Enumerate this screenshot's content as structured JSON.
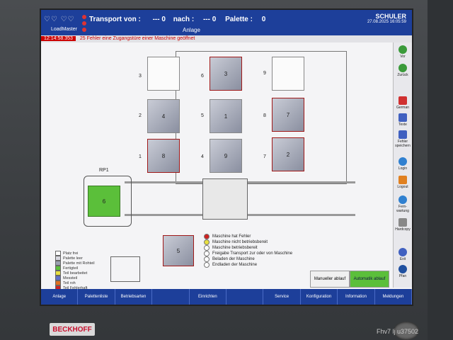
{
  "header": {
    "hearts": "♡♡ ♡♡",
    "loadmaster": "LoadMaster",
    "transport_label": "Transport von :",
    "transport_from": "---  0",
    "nach_label": "nach :",
    "transport_to": "---  0",
    "palette_label": "Palette :",
    "palette_value": "0",
    "anlage": "Anlage",
    "brand": "SCHULER",
    "datetime": "27.08.2025 16:05:59"
  },
  "alarm": {
    "time": "12:14:58.353",
    "count": "25",
    "message": "Fehler eine Zugangstüre einer Maschine geöffnet"
  },
  "stations": [
    {
      "label": "",
      "slot": "3"
    },
    {
      "label": "3",
      "slot": "6"
    },
    {
      "label": "",
      "slot": "9"
    },
    {
      "label": "4",
      "slot": "2"
    },
    {
      "label": "1",
      "slot": "5"
    },
    {
      "label": "7",
      "slot": "8"
    },
    {
      "label": "8",
      "slot": "1"
    },
    {
      "label": "9",
      "slot": "4"
    },
    {
      "label": "2",
      "slot": "7"
    }
  ],
  "rp_label": "RP1",
  "green_station": "6",
  "machine_station": "5",
  "legend": [
    {
      "label": "Platz frei",
      "color": "#ffffff"
    },
    {
      "label": "Palette leer",
      "color": "#d8d8e0"
    },
    {
      "label": "Palette mit Rohteil",
      "color": "#9aa0b0"
    },
    {
      "label": "Fertigteil",
      "color": "#5bbf3a"
    },
    {
      "label": "Teil bearbeitet",
      "color": "#e8e040"
    },
    {
      "label": "Messteil",
      "color": "#6070c8"
    },
    {
      "label": "Teil roh",
      "color": "#e07020"
    },
    {
      "label": "Teil Fehlerhaft",
      "color": "#d02020"
    }
  ],
  "legend_machine": [
    "Maschine hat Fehler",
    "Maschine nicht betriebsbereit",
    "Maschine betriebsbereit",
    "Freigabe Transport zur oder von Maschine",
    "Beladen der Maschine",
    "Endladen der Maschine"
  ],
  "buttons": {
    "manuell": "Manueller ablauf",
    "auto": "Automatik ablauf"
  },
  "sidebar": [
    {
      "label": "Vor",
      "color": "#3a9a3a"
    },
    {
      "label": "Zurück",
      "color": "#3a9a3a"
    },
    {
      "label": "German",
      "color": "#d03030"
    },
    {
      "label": "Texte",
      "color": "#4060c0"
    },
    {
      "label": "Fehler speichern",
      "color": "#4060c0"
    },
    {
      "label": "Login",
      "color": "#3080d0"
    },
    {
      "label": "Logout",
      "color": "#e08020"
    },
    {
      "label": "Fern-wartung",
      "color": "#3080d0"
    },
    {
      "label": "Hardcopy",
      "color": "#888888"
    },
    {
      "label": "Exit",
      "color": "#4060c0"
    },
    {
      "label": "Pfan",
      "color": "#2050a0"
    }
  ],
  "bottom_nav": [
    "Anlage",
    "Palettenliste",
    "Betriebsarten",
    "",
    "Einrichten",
    "",
    "Service",
    "Konfiguration",
    "Information",
    "Meldungen"
  ],
  "bezel": {
    "brand": "BECKHOFF",
    "watermark": "Fhv7 lj u37502"
  }
}
